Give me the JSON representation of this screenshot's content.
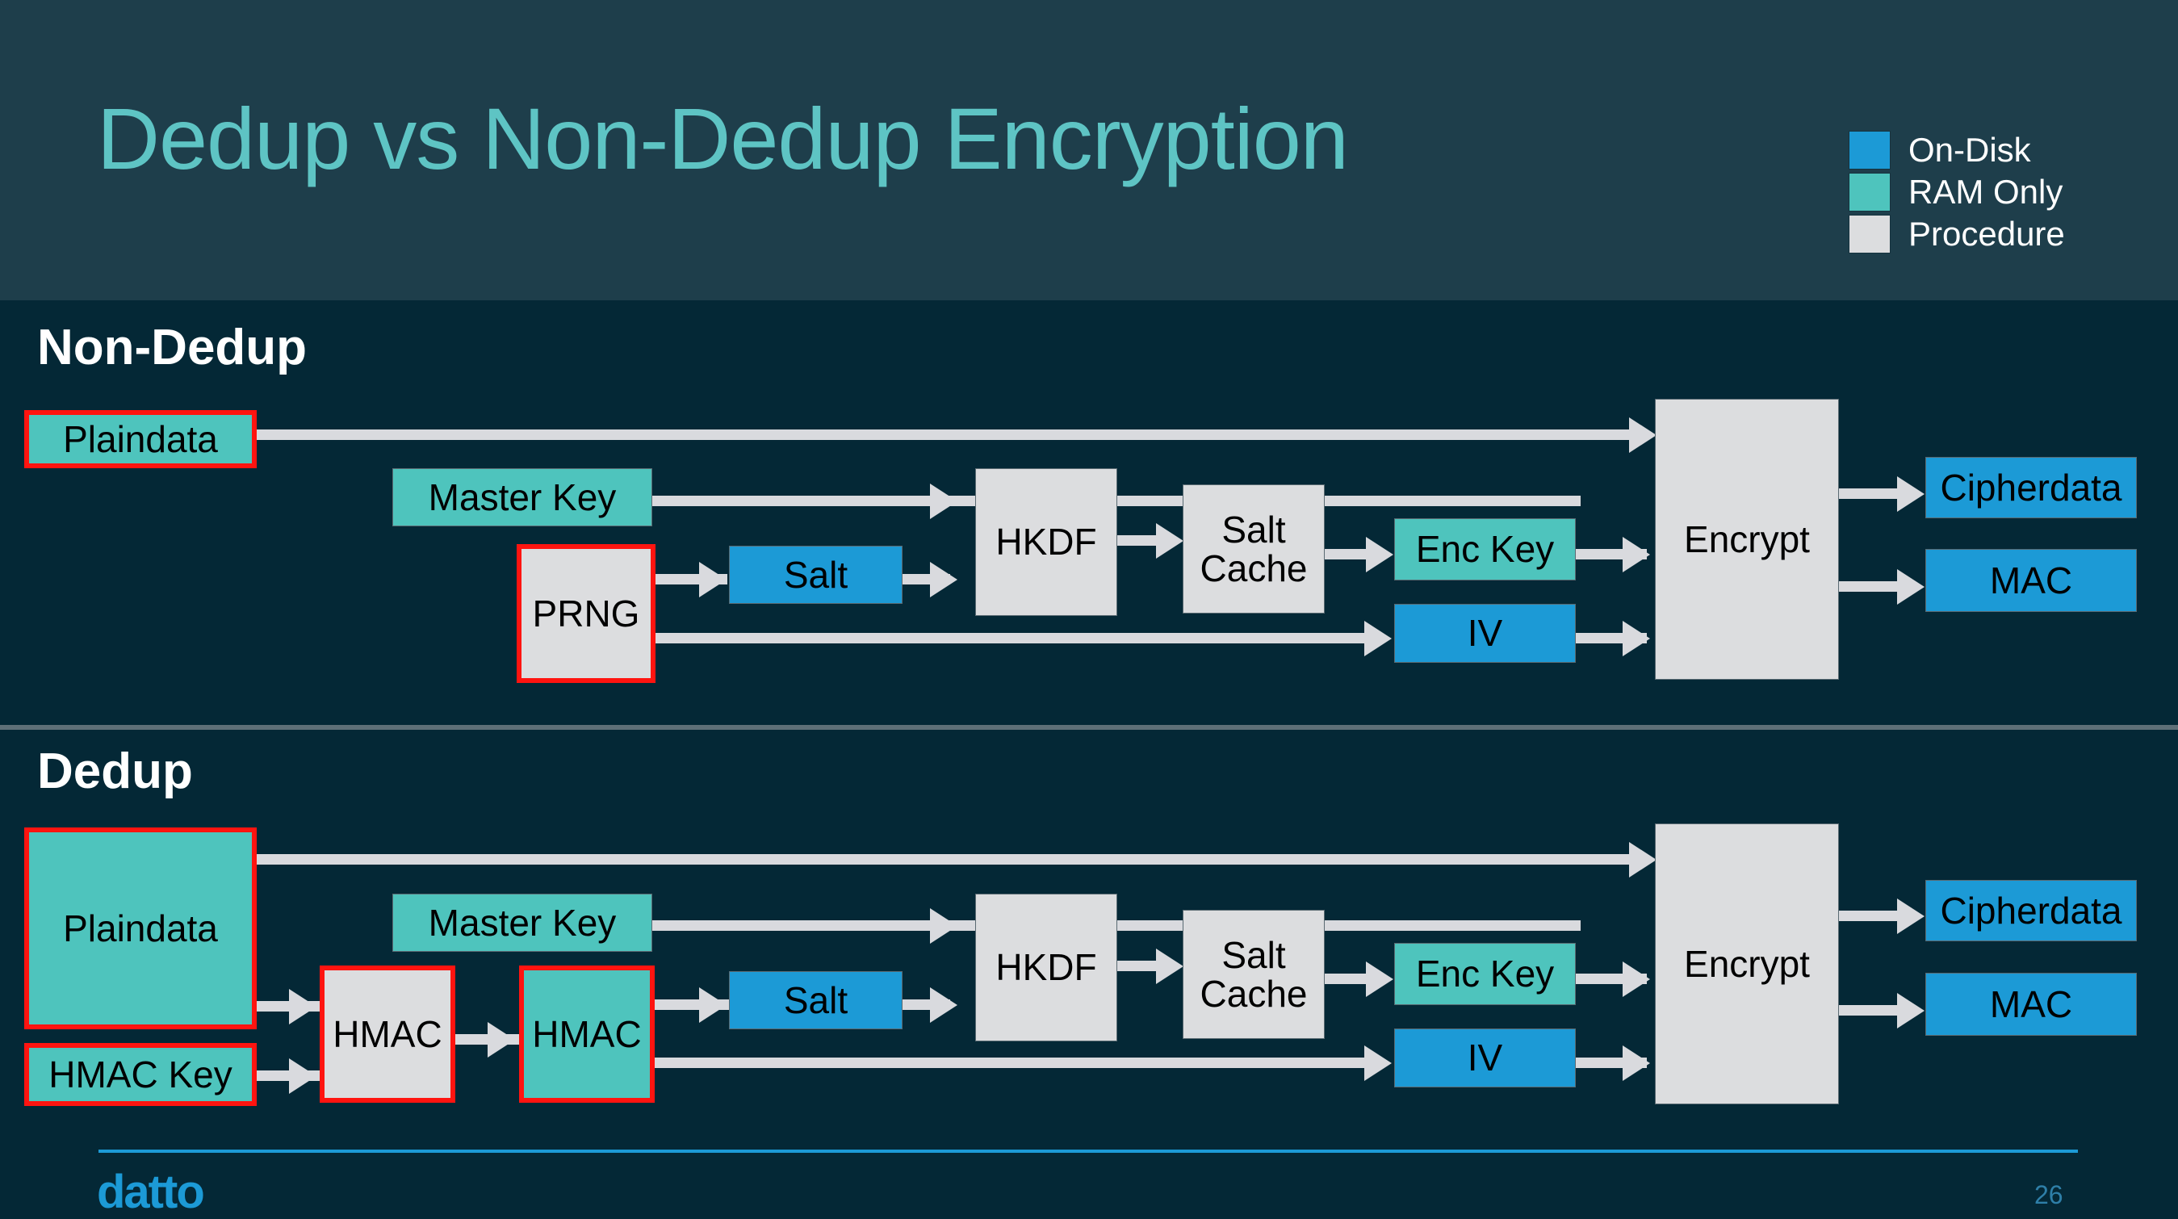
{
  "slide": {
    "title": "Dedup vs Non-Dedup Encryption",
    "brand": "datto",
    "page_number": "26"
  },
  "legend": {
    "items": [
      {
        "label": "On-Disk",
        "color": "#1c9ad6"
      },
      {
        "label": "RAM Only",
        "color": "#4ec4bd"
      },
      {
        "label": "Procedure",
        "color": "#dcdddf"
      }
    ]
  },
  "sections": {
    "non_dedup": {
      "label": "Non-Dedup"
    },
    "dedup": {
      "label": "Dedup"
    }
  },
  "diagram": {
    "type": "flow",
    "colors": {
      "on_disk": "#1c9ad6",
      "ram_only": "#4ec4bd",
      "procedure": "#dcdddf",
      "highlight": "#ff1410",
      "background": "#042836",
      "header": "#1e3e4b",
      "accent": "#5ec4c4"
    },
    "non_dedup_nodes": [
      {
        "id": "nd-plaindata",
        "label": "Plaindata",
        "kind": "ram_only",
        "highlighted": true
      },
      {
        "id": "nd-masterkey",
        "label": "Master Key",
        "kind": "ram_only",
        "highlighted": false
      },
      {
        "id": "nd-prng",
        "label": "PRNG",
        "kind": "procedure",
        "highlighted": true
      },
      {
        "id": "nd-salt",
        "label": "Salt",
        "kind": "on_disk",
        "highlighted": false
      },
      {
        "id": "nd-hkdf",
        "label": "HKDF",
        "kind": "procedure",
        "highlighted": false
      },
      {
        "id": "nd-saltcache",
        "label": "Salt\nCache",
        "kind": "procedure",
        "highlighted": false
      },
      {
        "id": "nd-enckey",
        "label": "Enc Key",
        "kind": "ram_only",
        "highlighted": false
      },
      {
        "id": "nd-iv",
        "label": "IV",
        "kind": "on_disk",
        "highlighted": false
      },
      {
        "id": "nd-encrypt",
        "label": "Encrypt",
        "kind": "procedure",
        "highlighted": false
      },
      {
        "id": "nd-cipherdata",
        "label": "Cipherdata",
        "kind": "on_disk",
        "highlighted": false
      },
      {
        "id": "nd-mac",
        "label": "MAC",
        "kind": "on_disk",
        "highlighted": false
      }
    ],
    "dedup_nodes": [
      {
        "id": "d-plaindata",
        "label": "Plaindata",
        "kind": "ram_only",
        "highlighted": true
      },
      {
        "id": "d-hmackey",
        "label": "HMAC Key",
        "kind": "ram_only",
        "highlighted": true
      },
      {
        "id": "d-hmac1",
        "label": "HMAC",
        "kind": "procedure",
        "highlighted": true
      },
      {
        "id": "d-hmac2",
        "label": "HMAC",
        "kind": "ram_only",
        "highlighted": true
      },
      {
        "id": "d-masterkey",
        "label": "Master Key",
        "kind": "ram_only",
        "highlighted": false
      },
      {
        "id": "d-salt",
        "label": "Salt",
        "kind": "on_disk",
        "highlighted": false
      },
      {
        "id": "d-hkdf",
        "label": "HKDF",
        "kind": "procedure",
        "highlighted": false
      },
      {
        "id": "d-saltcache",
        "label": "Salt\nCache",
        "kind": "procedure",
        "highlighted": false
      },
      {
        "id": "d-enckey",
        "label": "Enc Key",
        "kind": "ram_only",
        "highlighted": false
      },
      {
        "id": "d-iv",
        "label": "IV",
        "kind": "on_disk",
        "highlighted": false
      },
      {
        "id": "d-encrypt",
        "label": "Encrypt",
        "kind": "procedure",
        "highlighted": false
      },
      {
        "id": "d-cipherdata",
        "label": "Cipherdata",
        "kind": "on_disk",
        "highlighted": false
      },
      {
        "id": "d-mac",
        "label": "MAC",
        "kind": "on_disk",
        "highlighted": false
      }
    ]
  }
}
